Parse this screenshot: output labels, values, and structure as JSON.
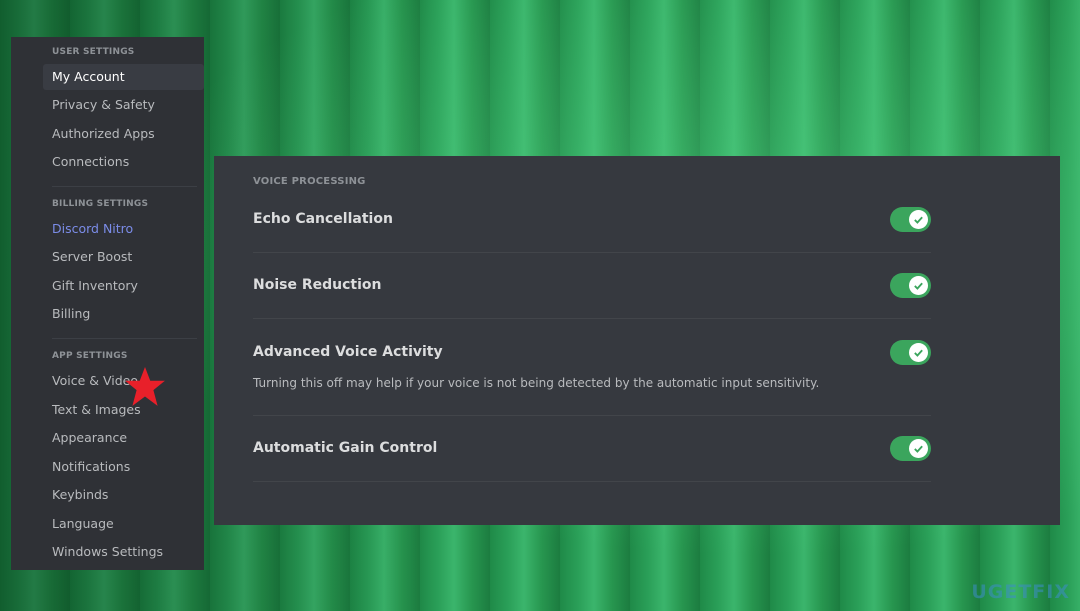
{
  "sidebar": {
    "user_settings": "USER SETTINGS",
    "user_items": [
      "My Account",
      "Privacy & Safety",
      "Authorized Apps",
      "Connections"
    ],
    "billing_settings": "BILLING SETTINGS",
    "billing_items": [
      "Discord Nitro",
      "Server Boost",
      "Gift Inventory",
      "Billing"
    ],
    "app_settings": "APP SETTINGS",
    "app_items": [
      "Voice & Video",
      "Text & Images",
      "Appearance",
      "Notifications",
      "Keybinds",
      "Language",
      "Windows Settings"
    ],
    "selected": "My Account"
  },
  "panel": {
    "header": "VOICE PROCESSING",
    "settings": [
      {
        "title": "Echo Cancellation",
        "enabled": true
      },
      {
        "title": "Noise Reduction",
        "enabled": true
      },
      {
        "title": "Advanced Voice Activity",
        "description": "Turning this off may help if your voice is not being detected by the automatic input sensitivity.",
        "enabled": true
      },
      {
        "title": "Automatic Gain Control",
        "enabled": true
      }
    ]
  },
  "colors": {
    "toggle_on": "#3ba55d",
    "nitro": "#7b8ce8",
    "annotation_star": "#e8202a"
  },
  "watermark": "UGETFIX"
}
